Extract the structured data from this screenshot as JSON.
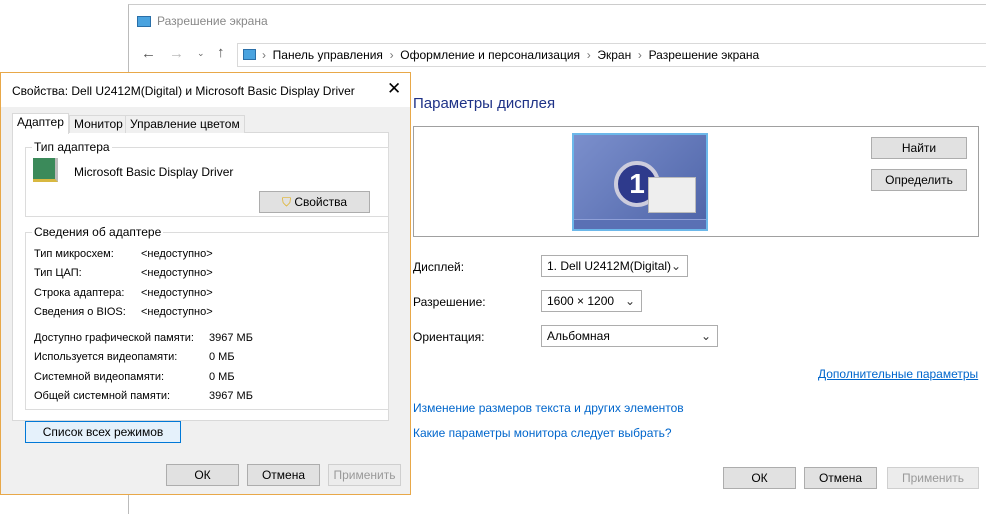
{
  "main": {
    "title": "Разрешение экрана",
    "breadcrumb": [
      "Панель управления",
      "Оформление и персонализация",
      "Экран",
      "Разрешение экрана"
    ],
    "heading": "Параметры дисплея",
    "find_button": "Найти",
    "identify_button": "Определить",
    "monitor_number": "1",
    "display_label": "Дисплей:",
    "display_value": "1. Dell U2412M(Digital)",
    "resolution_label": "Разрешение:",
    "resolution_value": "1600 × 1200",
    "orientation_label": "Ориентация:",
    "orientation_value": "Альбомная",
    "advanced_link": "Дополнительные параметры",
    "text_size_link": "Изменение размеров текста и других элементов",
    "which_settings_link": "Какие параметры монитора следует выбрать?",
    "ok": "ОК",
    "cancel": "Отмена",
    "apply": "Применить"
  },
  "dialog": {
    "title": "Свойства: Dell U2412M(Digital) и Microsoft Basic Display Driver",
    "tabs": [
      "Адаптер",
      "Монитор",
      "Управление цветом"
    ],
    "adapter_type_group": "Тип адаптера",
    "adapter_name": "Microsoft Basic Display Driver",
    "properties_button": "Свойства",
    "info_group": "Сведения об адаптере",
    "info": [
      {
        "k": "Тип микросхем:",
        "v": "<недоступно>"
      },
      {
        "k": "Тип ЦАП:",
        "v": "<недоступно>"
      },
      {
        "k": "Строка адаптера:",
        "v": "<недоступно>"
      },
      {
        "k": "Сведения о BIOS:",
        "v": "<недоступно>"
      }
    ],
    "memory": [
      {
        "k": "Доступно графической памяти:",
        "v": "3967 МБ"
      },
      {
        "k": "Используется видеопамяти:",
        "v": "0 МБ"
      },
      {
        "k": "Системной видеопамяти:",
        "v": "0 МБ"
      },
      {
        "k": "Общей системной памяти:",
        "v": "3967 МБ"
      }
    ],
    "list_modes_button": "Список всех режимов",
    "ok": "ОК",
    "cancel": "Отмена",
    "apply": "Применить"
  }
}
